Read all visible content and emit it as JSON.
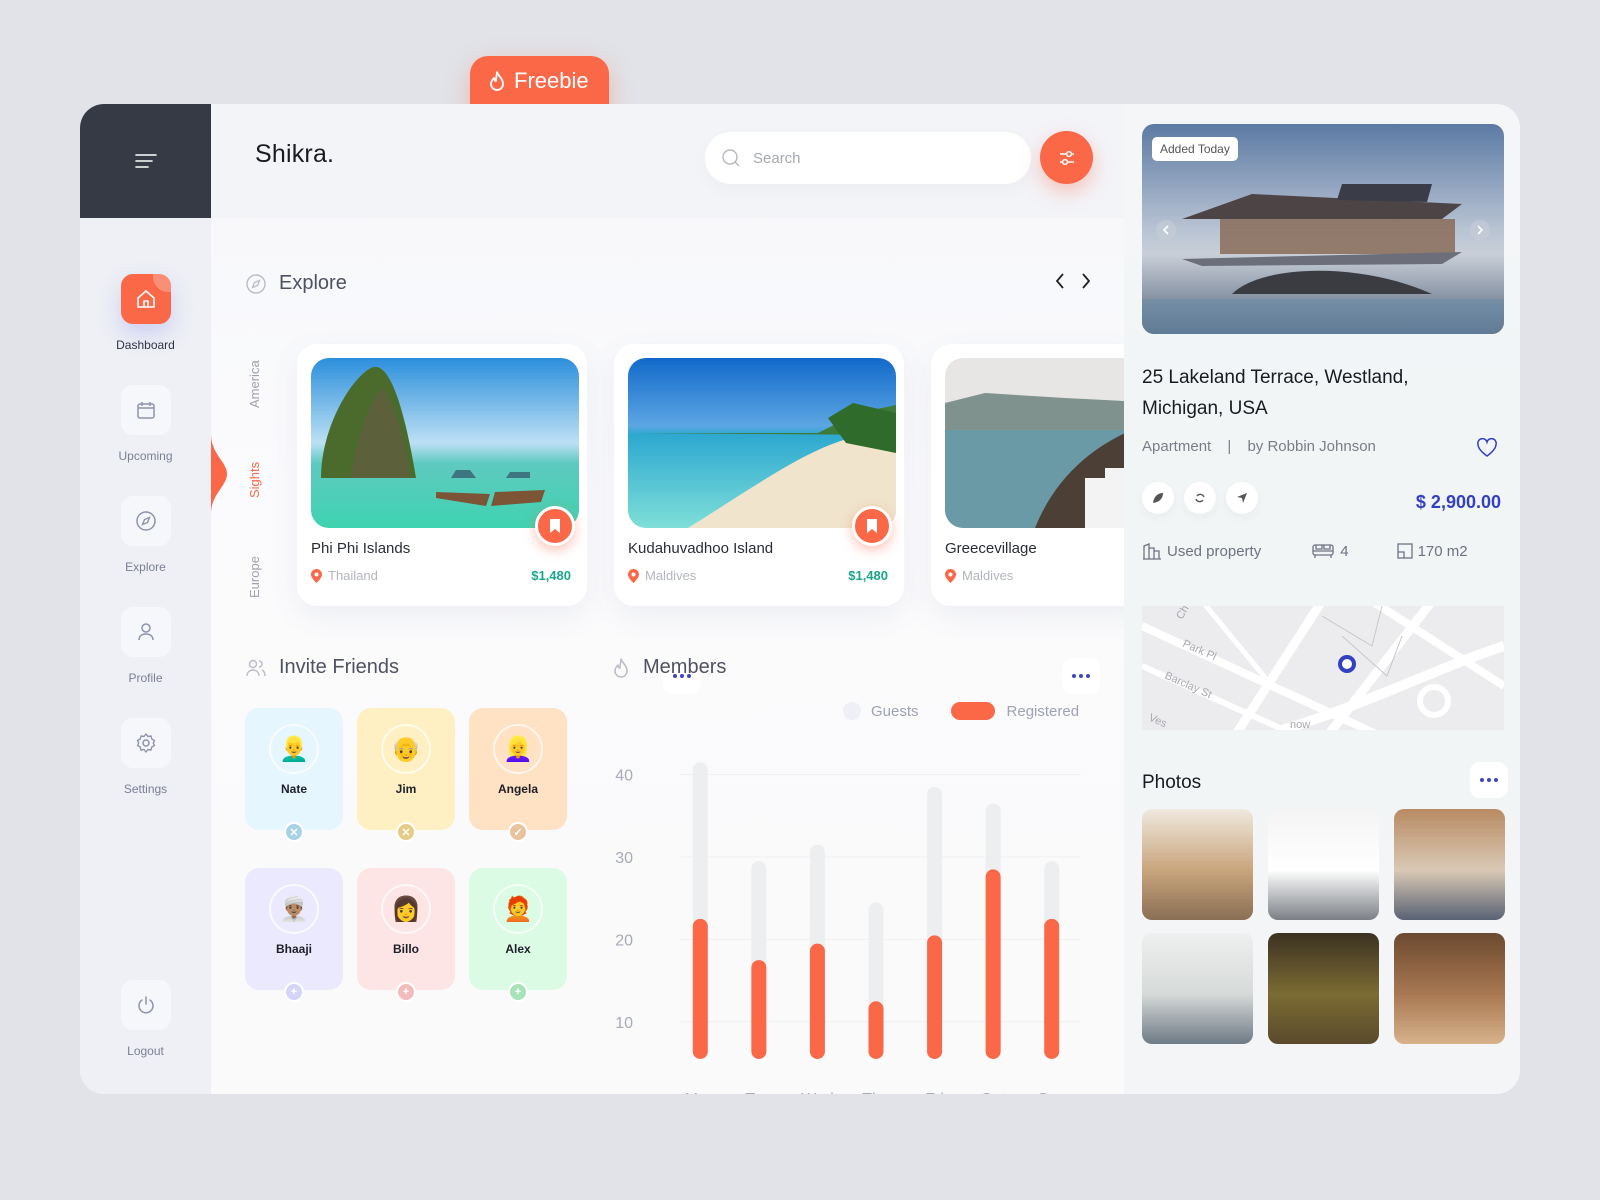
{
  "freebie": {
    "label": "Freebie",
    "icon": "flame-icon"
  },
  "app": {
    "logo": "Shikra.",
    "search": {
      "placeholder": "Search",
      "value": ""
    },
    "filter_icon": "sliders-icon"
  },
  "sidebar": {
    "menu_icon": "menu-icon",
    "items": [
      {
        "label": "Dashboard",
        "icon": "home-icon",
        "active": true
      },
      {
        "label": "Upcoming",
        "icon": "calendar-icon",
        "active": false
      },
      {
        "label": "Explore",
        "icon": "compass-icon",
        "active": false
      },
      {
        "label": "Profile",
        "icon": "user-icon",
        "active": false
      },
      {
        "label": "Settings",
        "icon": "gear-icon",
        "active": false
      }
    ],
    "logout": {
      "label": "Logout",
      "icon": "power-icon"
    }
  },
  "explore": {
    "title": "Explore",
    "tabs": [
      {
        "label": "America",
        "active": false
      },
      {
        "label": "Sights",
        "active": true
      },
      {
        "label": "Europe",
        "active": false
      }
    ],
    "cards": [
      {
        "name": "Phi Phi Islands",
        "location": "Thailand",
        "price": "$1,480",
        "bookmarked": true
      },
      {
        "name": "Kudahuvadhoo Island",
        "location": "Maldives",
        "price": "$1,480",
        "bookmarked": true
      },
      {
        "name": "Greecevillage",
        "location": "Maldives",
        "price": "",
        "bookmarked": false
      }
    ]
  },
  "invite": {
    "title": "Invite Friends",
    "friends": [
      {
        "name": "Nate",
        "emoji": "👱‍♂️",
        "bg": "#e6f6ff",
        "status": "remove",
        "status_color": "#a8d2e6"
      },
      {
        "name": "Jim",
        "emoji": "👴",
        "bg": "#fff0c4",
        "status": "remove",
        "status_color": "#e6cc84"
      },
      {
        "name": "Angela",
        "emoji": "👱‍♀️",
        "bg": "#ffe1c4",
        "status": "accepted",
        "status_color": "#e8c39e"
      },
      {
        "name": "Bhaaji",
        "emoji": "👳🏽‍♂️",
        "bg": "#ebe9fd",
        "status": "add",
        "status_color": "#d5d3f6"
      },
      {
        "name": "Billo",
        "emoji": "👩",
        "bg": "#fde5e5",
        "status": "add",
        "status_color": "#f2bcbc"
      },
      {
        "name": "Alex",
        "emoji": "🧑‍🦰",
        "bg": "#dcfbe4",
        "status": "add",
        "status_color": "#a8e2b8"
      }
    ]
  },
  "members": {
    "title": "Members",
    "legend": {
      "guests": "Guests",
      "registered": "Registered"
    }
  },
  "chart_data": {
    "type": "bar",
    "title": "Members",
    "categories": [
      "Mon",
      "Tue",
      "Wed",
      "Thu",
      "Fri",
      "Sat",
      "Sun"
    ],
    "series": [
      {
        "name": "Guests",
        "values": [
          41,
          29,
          31,
          24,
          38,
          36,
          29
        ],
        "color": "#eceef0"
      },
      {
        "name": "Registered",
        "values": [
          22,
          17,
          19,
          12,
          20,
          28,
          22
        ],
        "color": "#fa6848"
      }
    ],
    "yticks": [
      10,
      20,
      30,
      40
    ],
    "ylim": [
      5,
      42
    ],
    "xlabel": "",
    "ylabel": "",
    "grid": true,
    "legend": "top-right"
  },
  "property": {
    "tag": "Added Today",
    "address": "25 Lakeland Terrace, Westland, Michigan, USA",
    "type": "Apartment",
    "separator": "|",
    "agent": "by Robbin Johnson",
    "price": "$ 2,900.00",
    "features": [
      {
        "icon": "building-icon",
        "label": "Used property"
      },
      {
        "icon": "bed-icon",
        "label": "4"
      },
      {
        "icon": "area-icon",
        "label": "170 m2"
      }
    ],
    "map_labels": [
      "Park Pl",
      "Barclay St",
      "Ch",
      "Ves",
      "now"
    ],
    "accent": "#3340c4"
  },
  "photos": {
    "title": "Photos",
    "items": [
      "kitchen",
      "open kitchen",
      "bedroom",
      "sitting room",
      "classic lounge",
      "library living room"
    ]
  }
}
